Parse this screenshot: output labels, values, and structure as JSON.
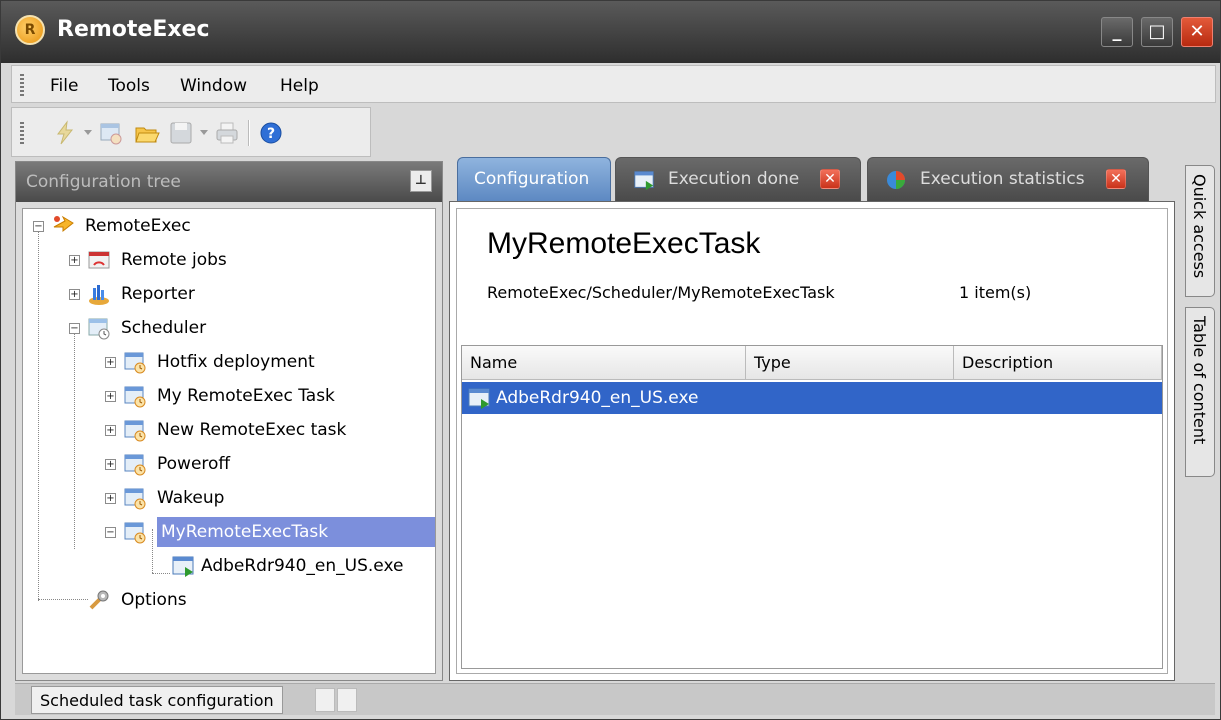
{
  "window": {
    "title": "RemoteExec",
    "app_icon_letter": "R"
  },
  "menu": {
    "items": [
      "File",
      "Tools",
      "Window",
      "Help"
    ]
  },
  "toolbar": {
    "icons": [
      "lightning-icon",
      "new-task-icon",
      "open-folder-icon",
      "save-icon",
      "print-icon",
      "help-icon"
    ]
  },
  "config_panel": {
    "title": "Configuration tree",
    "tree": [
      {
        "label": "RemoteExec",
        "icon": "remoteexec-icon"
      },
      {
        "label": "Remote jobs",
        "icon": "remote-jobs-icon"
      },
      {
        "label": "Reporter",
        "icon": "reporter-icon"
      },
      {
        "label": "Scheduler",
        "icon": "scheduler-icon"
      },
      {
        "label": "Hotfix deployment",
        "icon": "scheduled-task-icon"
      },
      {
        "label": "My RemoteExec Task",
        "icon": "scheduled-task-icon"
      },
      {
        "label": "New RemoteExec task",
        "icon": "scheduled-task-icon"
      },
      {
        "label": "Poweroff",
        "icon": "scheduled-task-icon"
      },
      {
        "label": "Wakeup",
        "icon": "scheduled-task-icon"
      },
      {
        "label": "MyRemoteExecTask",
        "icon": "scheduled-task-icon",
        "selected": true
      },
      {
        "label": "AdbeRdr940_en_US.exe",
        "icon": "executable-icon"
      },
      {
        "label": "Options",
        "icon": "options-icon"
      }
    ]
  },
  "tabs": [
    {
      "label": "Configuration",
      "active": true
    },
    {
      "label": "Execution done",
      "active": false
    },
    {
      "label": "Execution statistics",
      "active": false
    }
  ],
  "main": {
    "title": "MyRemoteExecTask",
    "path": "RemoteExec/Scheduler/MyRemoteExecTask",
    "count": "1 item(s)",
    "columns": [
      "Name",
      "Type",
      "Description"
    ],
    "rows": [
      {
        "name": "AdbeRdr940_en_US.exe",
        "type": "",
        "description": ""
      }
    ]
  },
  "side_tabs": [
    "Quick access",
    "Table of content"
  ],
  "status": {
    "text": "Scheduled task configuration"
  },
  "colors": {
    "selection": "#3165c8",
    "tree_selection": "#7c8fdc",
    "active_tab": "#5d89c2",
    "close": "#c9321a"
  }
}
